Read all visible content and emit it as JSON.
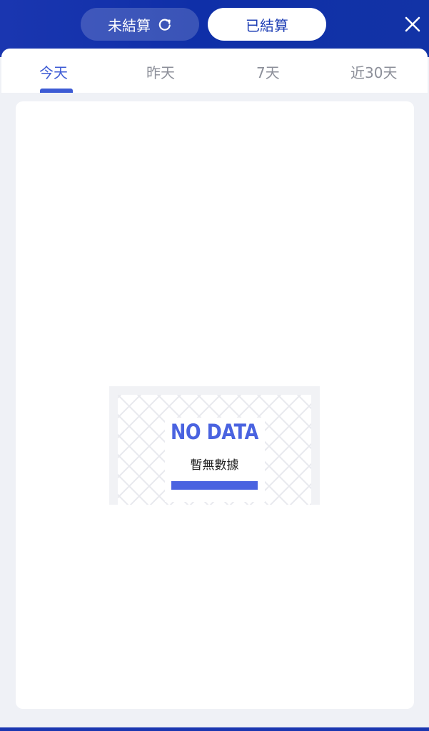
{
  "header": {
    "unsettled_label": "未結算",
    "settled_label": "已結算",
    "refresh_icon": "refresh-icon",
    "close_icon": "close-icon",
    "selected": "settled"
  },
  "tabs": [
    {
      "label": "今天",
      "active": true
    },
    {
      "label": "昨天",
      "active": false
    },
    {
      "label": "7天",
      "active": false
    },
    {
      "label": "近30天",
      "active": false
    }
  ],
  "empty_state": {
    "title": "NO DATA",
    "subtitle": "暫無數據",
    "illustration": "goal-net-icon"
  },
  "colors": {
    "header_bg": "#1233a6",
    "accent": "#3d5bd4",
    "page_bg": "#eff1f6",
    "tab_inactive": "#8c8f99"
  }
}
